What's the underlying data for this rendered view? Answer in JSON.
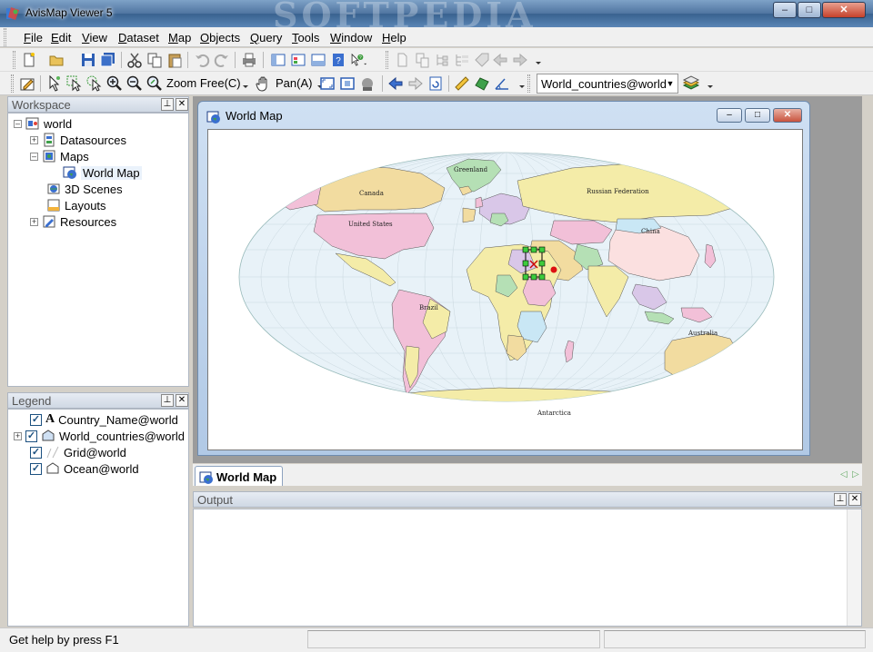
{
  "window": {
    "title": "AvisMap Viewer 5",
    "watermark": "SOFTPEDIA"
  },
  "menubar": [
    {
      "key": "F",
      "rest": "ile"
    },
    {
      "key": "E",
      "rest": "dit"
    },
    {
      "key": "V",
      "rest": "iew"
    },
    {
      "key": "D",
      "rest": "ataset"
    },
    {
      "key": "M",
      "rest": "ap"
    },
    {
      "key": "O",
      "rest": "bjects"
    },
    {
      "key": "Q",
      "rest": "uery"
    },
    {
      "key": "T",
      "rest": "ools"
    },
    {
      "key": "W",
      "rest": "indow"
    },
    {
      "key": "H",
      "rest": "elp"
    }
  ],
  "toolbar": {
    "zoom_label": "Zoom Free(C)",
    "pan_label": "Pan(A)",
    "layer_select": "World_countries@world"
  },
  "workspace": {
    "title": "Workspace",
    "root": "world",
    "nodes": {
      "datasources": "Datasources",
      "maps": "Maps",
      "world_map": "World Map",
      "scenes": "3D Scenes",
      "layouts": "Layouts",
      "resources": "Resources"
    }
  },
  "legend": {
    "title": "Legend",
    "layers": [
      "Country_Name@world",
      "World_countries@world",
      "Grid@world",
      "Ocean@world"
    ]
  },
  "map_window": {
    "title": "World Map",
    "labels": {
      "greenland": "Greenland",
      "canada": "Canada",
      "russia": "Russian Federation",
      "usa": "United States",
      "china": "China",
      "brazil": "Brazil",
      "australia": "Australia",
      "antarctica": "Antarctica"
    }
  },
  "doc_tab": "World Map",
  "output": {
    "title": "Output"
  },
  "status": {
    "text": "Get help by press F1"
  }
}
